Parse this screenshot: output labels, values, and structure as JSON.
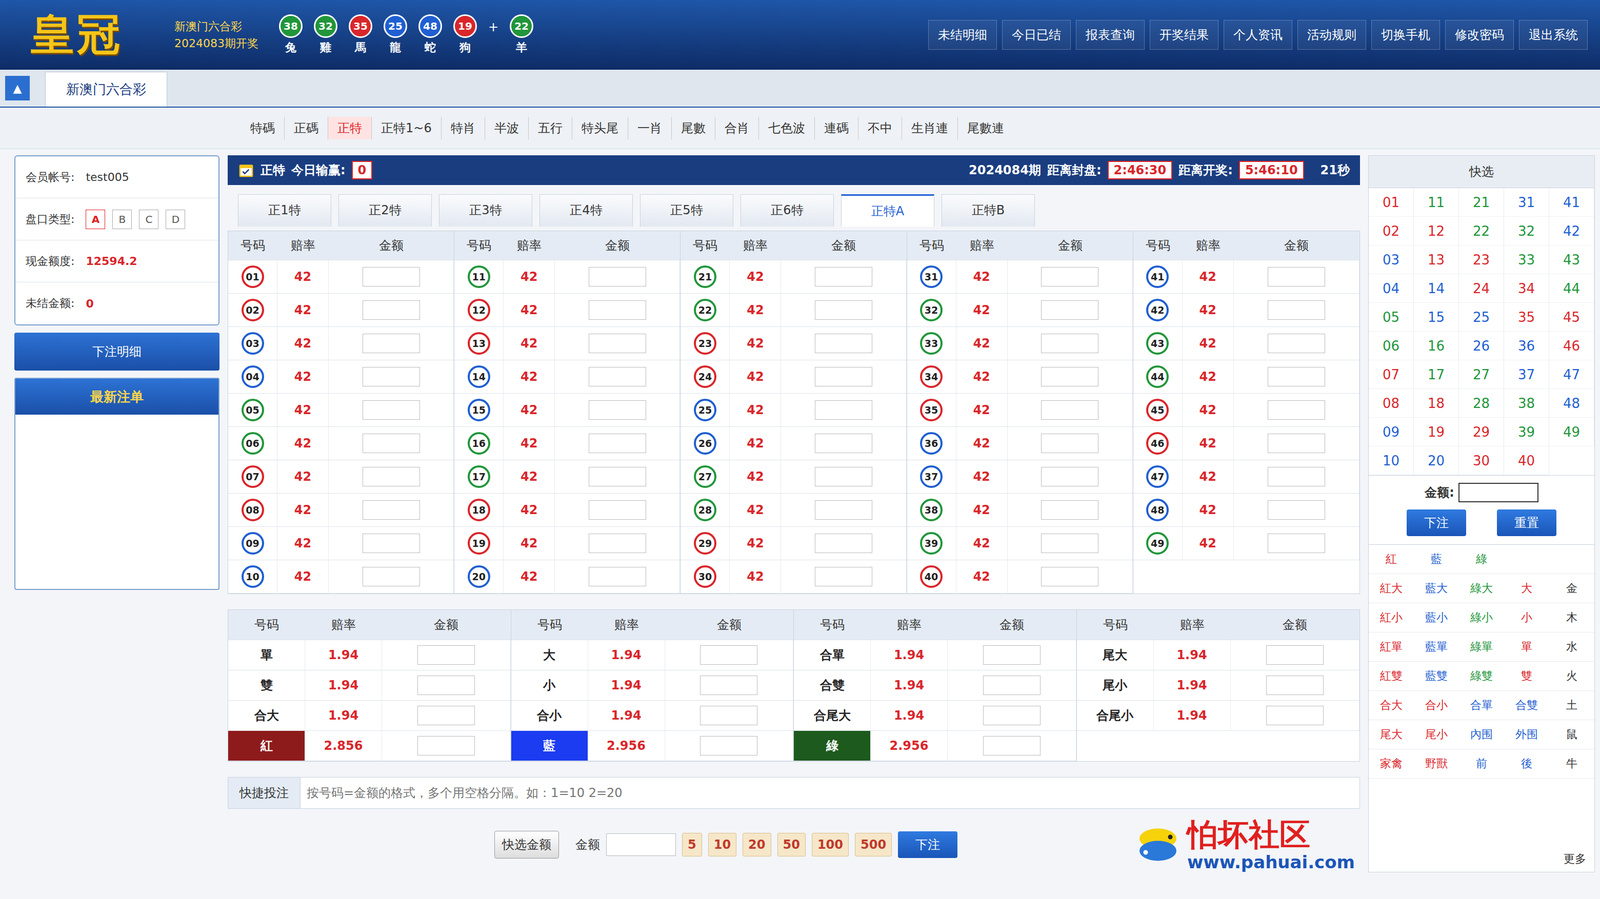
{
  "header": {
    "logo": "皇冠",
    "game": "新澳门六合彩",
    "lastIssue": "2024083期开奖",
    "balls": [
      {
        "num": "38",
        "zodiac": "兔",
        "color": "#21963a"
      },
      {
        "num": "32",
        "zodiac": "雞",
        "color": "#21963a"
      },
      {
        "num": "35",
        "zodiac": "馬",
        "color": "#d9262b"
      },
      {
        "num": "25",
        "zodiac": "龍",
        "color": "#1f5fd1"
      },
      {
        "num": "48",
        "zodiac": "蛇",
        "color": "#1f5fd1"
      },
      {
        "num": "19",
        "zodiac": "狗",
        "color": "#d9262b"
      }
    ],
    "plus": "+",
    "special": {
      "num": "22",
      "zodiac": "羊",
      "color": "#21963a"
    },
    "nav": [
      "未结明细",
      "今日已结",
      "报表查询",
      "开奖结果",
      "个人资讯",
      "活动规则",
      "切换手机",
      "修改密码",
      "退出系统"
    ]
  },
  "gameTab": {
    "toggle": "▲",
    "label": "新澳门六合彩"
  },
  "categories": [
    {
      "label": "特碼",
      "selected": false
    },
    {
      "label": "正碼",
      "selected": false
    },
    {
      "label": "正特",
      "selected": true
    },
    {
      "label": "正特1~6",
      "selected": false
    },
    {
      "label": "特肖",
      "selected": false
    },
    {
      "label": "半波",
      "selected": false
    },
    {
      "label": "五行",
      "selected": false
    },
    {
      "label": "特头尾",
      "selected": false
    },
    {
      "label": "一肖",
      "selected": false
    },
    {
      "label": "尾數",
      "selected": false
    },
    {
      "label": "合肖",
      "selected": false
    },
    {
      "label": "七色波",
      "selected": false
    },
    {
      "label": "連碼",
      "selected": false
    },
    {
      "label": "不中",
      "selected": false
    },
    {
      "label": "生肖連",
      "selected": false
    },
    {
      "label": "尾數連",
      "selected": false
    }
  ],
  "account": {
    "rows": [
      {
        "label": "会员帐号:",
        "kind": "text",
        "value": "test005",
        "options": []
      },
      {
        "label": "盘口类型:",
        "kind": "options",
        "value": "",
        "options": [
          {
            "label": "A",
            "selected": true
          },
          {
            "label": "B",
            "selected": false
          },
          {
            "label": "C",
            "selected": false
          },
          {
            "label": "D",
            "selected": false
          }
        ]
      },
      {
        "label": "现金额度:",
        "kind": "money",
        "value": "12594.2",
        "options": []
      },
      {
        "label": "未结金额:",
        "kind": "money",
        "value": "0",
        "options": []
      }
    ],
    "button": "下注明细",
    "latestTitle": "最新注单"
  },
  "titleBar": {
    "game": "正特",
    "winLabel": "今日输赢:",
    "win": "0",
    "issue": "2024084期",
    "closeLabel": "距离封盘:",
    "close": "2:46:30",
    "openLabel": "距离开奖:",
    "open": "5:46:10",
    "seconds": "21秒"
  },
  "subTabs": [
    {
      "label": "正1特",
      "selected": false
    },
    {
      "label": "正2特",
      "selected": false
    },
    {
      "label": "正3特",
      "selected": false
    },
    {
      "label": "正4特",
      "selected": false
    },
    {
      "label": "正5特",
      "selected": false
    },
    {
      "label": "正6特",
      "selected": false
    },
    {
      "label": "正特A",
      "selected": true
    },
    {
      "label": "正特B",
      "selected": false
    }
  ],
  "numberTable": {
    "columns": [
      "号码",
      "赔率",
      "金额"
    ],
    "groups": [
      [
        {
          "num": "01",
          "odds": "42",
          "color": "#d9262b"
        },
        {
          "num": "02",
          "odds": "42",
          "color": "#d9262b"
        },
        {
          "num": "03",
          "odds": "42",
          "color": "#1f5fd1"
        },
        {
          "num": "04",
          "odds": "42",
          "color": "#1f5fd1"
        },
        {
          "num": "05",
          "odds": "42",
          "color": "#21963a"
        },
        {
          "num": "06",
          "odds": "42",
          "color": "#21963a"
        },
        {
          "num": "07",
          "odds": "42",
          "color": "#d9262b"
        },
        {
          "num": "08",
          "odds": "42",
          "color": "#d9262b"
        },
        {
          "num": "09",
          "odds": "42",
          "color": "#1f5fd1"
        },
        {
          "num": "10",
          "odds": "42",
          "color": "#1f5fd1"
        }
      ],
      [
        {
          "num": "11",
          "odds": "42",
          "color": "#21963a"
        },
        {
          "num": "12",
          "odds": "42",
          "color": "#d9262b"
        },
        {
          "num": "13",
          "odds": "42",
          "color": "#d9262b"
        },
        {
          "num": "14",
          "odds": "42",
          "color": "#1f5fd1"
        },
        {
          "num": "15",
          "odds": "42",
          "color": "#1f5fd1"
        },
        {
          "num": "16",
          "odds": "42",
          "color": "#21963a"
        },
        {
          "num": "17",
          "odds": "42",
          "color": "#21963a"
        },
        {
          "num": "18",
          "odds": "42",
          "color": "#d9262b"
        },
        {
          "num": "19",
          "odds": "42",
          "color": "#d9262b"
        },
        {
          "num": "20",
          "odds": "42",
          "color": "#1f5fd1"
        }
      ],
      [
        {
          "num": "21",
          "odds": "42",
          "color": "#21963a"
        },
        {
          "num": "22",
          "odds": "42",
          "color": "#21963a"
        },
        {
          "num": "23",
          "odds": "42",
          "color": "#d9262b"
        },
        {
          "num": "24",
          "odds": "42",
          "color": "#d9262b"
        },
        {
          "num": "25",
          "odds": "42",
          "color": "#1f5fd1"
        },
        {
          "num": "26",
          "odds": "42",
          "color": "#1f5fd1"
        },
        {
          "num": "27",
          "odds": "42",
          "color": "#21963a"
        },
        {
          "num": "28",
          "odds": "42",
          "color": "#21963a"
        },
        {
          "num": "29",
          "odds": "42",
          "color": "#d9262b"
        },
        {
          "num": "30",
          "odds": "42",
          "color": "#d9262b"
        }
      ],
      [
        {
          "num": "31",
          "odds": "42",
          "color": "#1f5fd1"
        },
        {
          "num": "32",
          "odds": "42",
          "color": "#21963a"
        },
        {
          "num": "33",
          "odds": "42",
          "color": "#21963a"
        },
        {
          "num": "34",
          "odds": "42",
          "color": "#d9262b"
        },
        {
          "num": "35",
          "odds": "42",
          "color": "#d9262b"
        },
        {
          "num": "36",
          "odds": "42",
          "color": "#1f5fd1"
        },
        {
          "num": "37",
          "odds": "42",
          "color": "#1f5fd1"
        },
        {
          "num": "38",
          "odds": "42",
          "color": "#21963a"
        },
        {
          "num": "39",
          "odds": "42",
          "color": "#21963a"
        },
        {
          "num": "40",
          "odds": "42",
          "color": "#d9262b"
        }
      ],
      [
        {
          "num": "41",
          "odds": "42",
          "color": "#1f5fd1"
        },
        {
          "num": "42",
          "odds": "42",
          "color": "#1f5fd1"
        },
        {
          "num": "43",
          "odds": "42",
          "color": "#21963a"
        },
        {
          "num": "44",
          "odds": "42",
          "color": "#21963a"
        },
        {
          "num": "45",
          "odds": "42",
          "color": "#d9262b"
        },
        {
          "num": "46",
          "odds": "42",
          "color": "#d9262b"
        },
        {
          "num": "47",
          "odds": "42",
          "color": "#1f5fd1"
        },
        {
          "num": "48",
          "odds": "42",
          "color": "#1f5fd1"
        },
        {
          "num": "49",
          "odds": "42",
          "color": "#21963a"
        }
      ]
    ]
  },
  "sideTable": {
    "columns": [
      "号码",
      "赔率",
      "金额"
    ],
    "groups": [
      [
        {
          "label": "單",
          "odds": "1.94",
          "kind": "plain",
          "color": ""
        },
        {
          "label": "雙",
          "odds": "1.94",
          "kind": "plain",
          "color": ""
        },
        {
          "label": "合大",
          "odds": "1.94",
          "kind": "plain",
          "color": ""
        },
        {
          "label": "紅",
          "odds": "2.856",
          "kind": "wave",
          "color": "#8e1b1b"
        }
      ],
      [
        {
          "label": "大",
          "odds": "1.94",
          "kind": "plain",
          "color": ""
        },
        {
          "label": "小",
          "odds": "1.94",
          "kind": "plain",
          "color": ""
        },
        {
          "label": "合小",
          "odds": "1.94",
          "kind": "plain",
          "color": ""
        },
        {
          "label": "藍",
          "odds": "2.956",
          "kind": "wave",
          "color": "#1b3cf0"
        }
      ],
      [
        {
          "label": "合單",
          "odds": "1.94",
          "kind": "plain",
          "color": ""
        },
        {
          "label": "合雙",
          "odds": "1.94",
          "kind": "plain",
          "color": ""
        },
        {
          "label": "合尾大",
          "odds": "1.94",
          "kind": "plain",
          "color": ""
        },
        {
          "label": "綠",
          "odds": "2.956",
          "kind": "wave",
          "color": "#1d5a1d"
        }
      ],
      [
        {
          "label": "尾大",
          "odds": "1.94",
          "kind": "plain",
          "color": ""
        },
        {
          "label": "尾小",
          "odds": "1.94",
          "kind": "plain",
          "color": ""
        },
        {
          "label": "合尾小",
          "odds": "1.94",
          "kind": "plain",
          "color": ""
        }
      ]
    ]
  },
  "quickBet": {
    "label": "快捷投注",
    "placeholder": "按号码=金额的格式，多个用空格分隔。如：1=10 2=20"
  },
  "bottomBar": {
    "quickAmount": "快选金额",
    "amountLabel": "金额",
    "chips": [
      "5",
      "10",
      "20",
      "50",
      "100",
      "500"
    ],
    "submit": "下注"
  },
  "watermark": {
    "text": "怕坏社区",
    "url": "www.pahuai.com"
  },
  "quickPick": {
    "title": "快选",
    "numbers": [
      {
        "num": "01",
        "color": "#d9262b"
      },
      {
        "num": "02",
        "color": "#d9262b"
      },
      {
        "num": "03",
        "color": "#1f5fd1"
      },
      {
        "num": "04",
        "color": "#1f5fd1"
      },
      {
        "num": "05",
        "color": "#21963a"
      },
      {
        "num": "06",
        "color": "#21963a"
      },
      {
        "num": "07",
        "color": "#d9262b"
      },
      {
        "num": "08",
        "color": "#d9262b"
      },
      {
        "num": "09",
        "color": "#1f5fd1"
      },
      {
        "num": "10",
        "color": "#1f5fd1"
      },
      {
        "num": "11",
        "color": "#21963a"
      },
      {
        "num": "12",
        "color": "#d9262b"
      },
      {
        "num": "13",
        "color": "#d9262b"
      },
      {
        "num": "14",
        "color": "#1f5fd1"
      },
      {
        "num": "15",
        "color": "#1f5fd1"
      },
      {
        "num": "16",
        "color": "#21963a"
      },
      {
        "num": "17",
        "color": "#21963a"
      },
      {
        "num": "18",
        "color": "#d9262b"
      },
      {
        "num": "19",
        "color": "#d9262b"
      },
      {
        "num": "20",
        "color": "#1f5fd1"
      },
      {
        "num": "21",
        "color": "#21963a"
      },
      {
        "num": "22",
        "color": "#21963a"
      },
      {
        "num": "23",
        "color": "#d9262b"
      },
      {
        "num": "24",
        "color": "#d9262b"
      },
      {
        "num": "25",
        "color": "#1f5fd1"
      },
      {
        "num": "26",
        "color": "#1f5fd1"
      },
      {
        "num": "27",
        "color": "#21963a"
      },
      {
        "num": "28",
        "color": "#21963a"
      },
      {
        "num": "29",
        "color": "#d9262b"
      },
      {
        "num": "30",
        "color": "#d9262b"
      },
      {
        "num": "31",
        "color": "#1f5fd1"
      },
      {
        "num": "32",
        "color": "#21963a"
      },
      {
        "num": "33",
        "color": "#21963a"
      },
      {
        "num": "34",
        "color": "#d9262b"
      },
      {
        "num": "35",
        "color": "#d9262b"
      },
      {
        "num": "36",
        "color": "#1f5fd1"
      },
      {
        "num": "37",
        "color": "#1f5fd1"
      },
      {
        "num": "38",
        "color": "#21963a"
      },
      {
        "num": "39",
        "color": "#21963a"
      },
      {
        "num": "40",
        "color": "#d9262b"
      },
      {
        "num": "41",
        "color": "#1f5fd1"
      },
      {
        "num": "42",
        "color": "#1f5fd1"
      },
      {
        "num": "43",
        "color": "#21963a"
      },
      {
        "num": "44",
        "color": "#21963a"
      },
      {
        "num": "45",
        "color": "#d9262b"
      },
      {
        "num": "46",
        "color": "#d9262b"
      },
      {
        "num": "47",
        "color": "#1f5fd1"
      },
      {
        "num": "48",
        "color": "#1f5fd1"
      },
      {
        "num": "49",
        "color": "#21963a"
      }
    ],
    "amountLabel": "金额:",
    "buttons": [
      "下注",
      "重置"
    ],
    "shortcuts": [
      [
        {
          "label": "紅",
          "color": "#d9262b"
        },
        {
          "label": "藍",
          "color": "#1f5fd1"
        },
        {
          "label": "綠",
          "color": "#21963a"
        }
      ],
      [
        {
          "label": "紅大",
          "color": "#d9262b"
        },
        {
          "label": "藍大",
          "color": "#1f5fd1"
        },
        {
          "label": "綠大",
          "color": "#21963a"
        },
        {
          "label": "大",
          "color": "#d9262b"
        },
        {
          "label": "金",
          "color": "#333333"
        }
      ],
      [
        {
          "label": "紅小",
          "color": "#d9262b"
        },
        {
          "label": "藍小",
          "color": "#1f5fd1"
        },
        {
          "label": "綠小",
          "color": "#21963a"
        },
        {
          "label": "小",
          "color": "#d9262b"
        },
        {
          "label": "木",
          "color": "#333333"
        }
      ],
      [
        {
          "label": "紅單",
          "color": "#d9262b"
        },
        {
          "label": "藍單",
          "color": "#1f5fd1"
        },
        {
          "label": "綠單",
          "color": "#21963a"
        },
        {
          "label": "單",
          "color": "#d9262b"
        },
        {
          "label": "水",
          "color": "#333333"
        }
      ],
      [
        {
          "label": "紅雙",
          "color": "#d9262b"
        },
        {
          "label": "藍雙",
          "color": "#1f5fd1"
        },
        {
          "label": "綠雙",
          "color": "#21963a"
        },
        {
          "label": "雙",
          "color": "#d9262b"
        },
        {
          "label": "火",
          "color": "#333333"
        }
      ],
      [
        {
          "label": "合大",
          "color": "#d9262b"
        },
        {
          "label": "合小",
          "color": "#d9262b"
        },
        {
          "label": "合單",
          "color": "#1f5fd1"
        },
        {
          "label": "合雙",
          "color": "#1f5fd1"
        },
        {
          "label": "土",
          "color": "#333333"
        }
      ],
      [
        {
          "label": "尾大",
          "color": "#d9262b"
        },
        {
          "label": "尾小",
          "color": "#d9262b"
        },
        {
          "label": "內围",
          "color": "#1f5fd1"
        },
        {
          "label": "外围",
          "color": "#1f5fd1"
        },
        {
          "label": "鼠",
          "color": "#333333"
        }
      ],
      [
        {
          "label": "家禽",
          "color": "#d9262b"
        },
        {
          "label": "野獸",
          "color": "#d9262b"
        },
        {
          "label": "前",
          "color": "#1f5fd1"
        },
        {
          "label": "後",
          "color": "#1f5fd1"
        },
        {
          "label": "牛",
          "color": "#333333"
        }
      ]
    ],
    "more": "更多"
  }
}
